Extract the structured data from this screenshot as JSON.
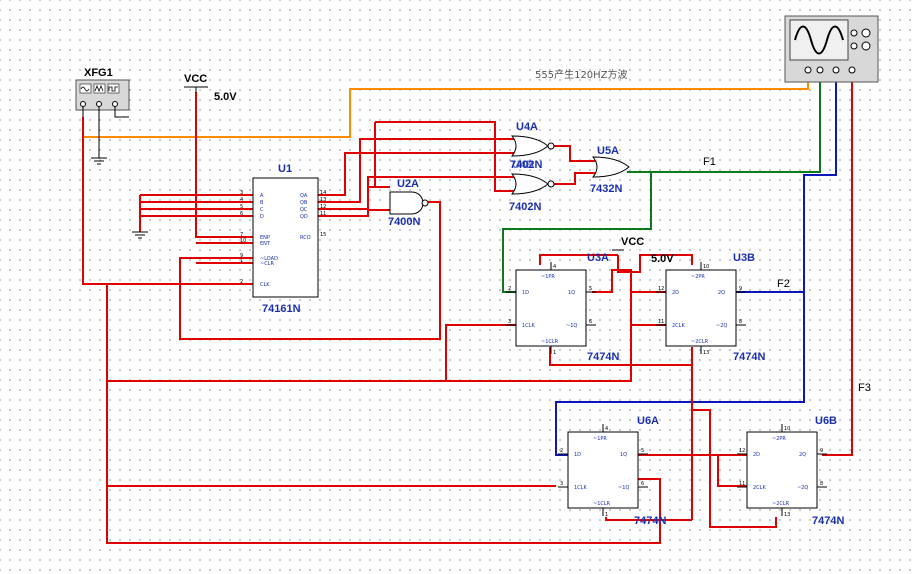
{
  "note": "555产生120HZ方波",
  "vcc": {
    "name": "VCC",
    "voltage": "5.0V"
  },
  "vcc2": {
    "name": "VCC",
    "voltage": "5.0V"
  },
  "generator": {
    "name": "XFG1"
  },
  "nets": {
    "f1": "F1",
    "f2": "F2",
    "f3": "F3"
  },
  "u1": {
    "ref": "U1",
    "part": "74161N",
    "left_pins": [
      "A",
      "B",
      "C",
      "D",
      "ENP",
      "ENT",
      "~LOAD",
      "~CLR",
      "CLK"
    ],
    "right_pins": [
      "QA",
      "QB",
      "QC",
      "QD",
      "RCO"
    ],
    "left_nums": [
      "3",
      "4",
      "5",
      "6",
      "7",
      "10",
      "9",
      "1",
      "2"
    ],
    "right_nums": [
      "14",
      "13",
      "12",
      "11",
      "15"
    ]
  },
  "u2a": {
    "ref": "U2A",
    "part": "7400N"
  },
  "u4a": {
    "ref": "U4A",
    "part": "7402N",
    "overlap_ref": "U4B"
  },
  "u4b": {
    "part": "7402N"
  },
  "u5a": {
    "ref": "U5A",
    "part": "7432N"
  },
  "u3a": {
    "ref": "U3A",
    "part": "7474N"
  },
  "u3b": {
    "ref": "U3B",
    "part": "7474N"
  },
  "u6a": {
    "ref": "U6A",
    "part": "7474N"
  },
  "u6b": {
    "ref": "U6B",
    "part": "7474N"
  },
  "ff_pins": {
    "a": {
      "pr": "~1PR",
      "d": "1D",
      "clk": "1CLK",
      "clr": "~1CLR",
      "q": "1Q",
      "qn": "~1Q"
    },
    "b": {
      "pr": "~2PR",
      "d": "2D",
      "clk": "2CLK",
      "clr": "~2CLR",
      "q": "2Q",
      "qn": "~2Q"
    }
  },
  "ff_nums": {
    "a": {
      "pr": "4",
      "d": "2",
      "clk": "3",
      "clr": "1",
      "q": "5",
      "qn": "6"
    },
    "b": {
      "pr": "10",
      "d": "12",
      "clk": "11",
      "clr": "13",
      "q": "9",
      "qn": "8"
    }
  },
  "colors": {
    "wire": "#e00000",
    "wire_f1": "#0a7a1c",
    "wire_f2": "#0b17b8",
    "probe": "#ff8c00",
    "ref_label": "#1a2fb0"
  }
}
